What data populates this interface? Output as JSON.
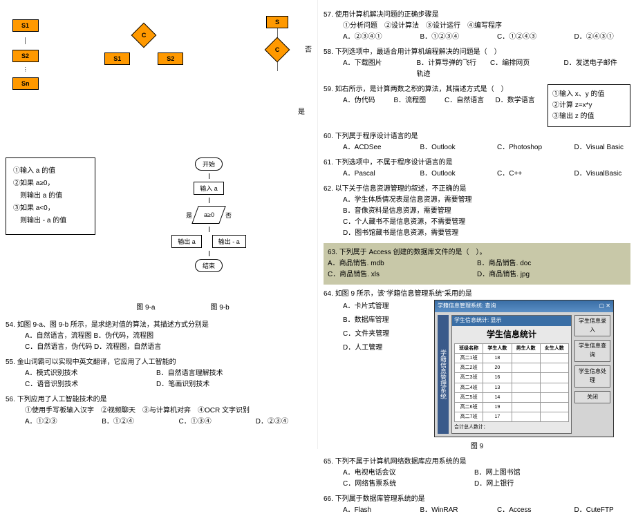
{
  "left": {
    "diag_seq": {
      "s1": "S1",
      "s2": "S2",
      "sn": "Sn"
    },
    "diag_branch": {
      "c": "C",
      "s1": "S1",
      "s2": "S2"
    },
    "diag_loop": {
      "s": "S",
      "c": "C",
      "no": "否",
      "yes": "是"
    },
    "pseudo": {
      "l1": "①输入 a 的值",
      "l2": "②如果 a≥0，",
      "l3": "则输出 a 的值",
      "l4": "③如果 a<0，",
      "l5": "则输出 - a 的值"
    },
    "flowchart": {
      "start": "开始",
      "input": "输入 a",
      "cond": "a≥0",
      "no": "否",
      "yes": "是",
      "out1": "输出 a",
      "out2": "输出 - a",
      "end": "结束"
    },
    "fig_a": "图 9-a",
    "fig_b": "图 9-b",
    "q54": {
      "num": "54.",
      "text": "如图 9-a、图 9-b 所示，是求绝对值的算法，其描述方式分别是",
      "a": "A．自然语言，流程图  B．伪代码，流程图",
      "c": "C．自然语言，伪代码  D．流程图，自然语言"
    },
    "q55": {
      "num": "55.",
      "text": "金山词霸可以实现中英文翻译，它应用了人工智能的",
      "a": "A．模式识别技术",
      "b": "B．自然语言理解技术",
      "c": "C．语音识别技术",
      "d": "D．笔画识别技术"
    },
    "q56": {
      "num": "56.",
      "text": "下列应用了人工智能技术的是",
      "sub": "①使用手写板输入汉字　②视频聊天　③与计算机对弈　④OCR 文字识别",
      "a": "A．①②③",
      "b": "B．①②④",
      "c": "C．①③④",
      "d": "D．②③④"
    }
  },
  "right": {
    "q57": {
      "num": "57.",
      "text": "使用计算机解决问题的正确步骤是",
      "sub": "①分析问题　②设计算法　③设计运行　④编写程序",
      "a": "A．②③④①",
      "b": "B．①②③④",
      "c": "C．①②④③",
      "d": "D．②④③①"
    },
    "q58": {
      "num": "58.",
      "text": "下列选项中，最适合用计算机编程解决的问题是（　）",
      "a": "A．下载图片",
      "b": "B．计算导弹的飞行轨迹",
      "c": "C．编排网页",
      "d": "D．发送电子邮件"
    },
    "q59": {
      "num": "59.",
      "text": "如右所示，是计算两数之积的算法，其描述方式是（　）",
      "a": "A．伪代码",
      "b": "B．流程图",
      "c": "C．自然语言",
      "d": "D．数学语言",
      "box1": "①输入 x、y 的值",
      "box2": "②计算 z=x*y",
      "box3": "③输出 z 的值"
    },
    "q60": {
      "num": "60.",
      "text": "下列属于程序设计语言的是",
      "a": "A．ACDSee",
      "b": "B．Outlook",
      "c": "C．Photoshop",
      "d": "D．Visual Basic"
    },
    "q61": {
      "num": "61.",
      "text": "下列选项中，不属于程序设计语言的是",
      "a": "A．Pascal",
      "b": "B．Outlook",
      "c": "C．C++",
      "d": "D．VisualBasic"
    },
    "q62": {
      "num": "62.",
      "text": "以下关于信息资源管理的叙述，不正确的是",
      "a": "A．学生体质情况表是信息资源，需要管理",
      "b": "B．音像资料是信息资源，需要管理",
      "c": "C．个人藏书不是信息资源，不需要管理",
      "d": "D．图书馆藏书是信息资源，需要管理"
    },
    "q63": {
      "num": "63.",
      "text": "下列属于 Access 创建的数据库文件的是（　）。",
      "a": "A．商品销售. mdb",
      "b": "B．商品销售. doc",
      "c": "C．商品销售. xls",
      "d": "D．商品销售. jpg"
    },
    "q64": {
      "num": "64.",
      "text": "如图 9 所示，该\"学籍信息管理系统\"采用的是",
      "a": "A．卡片式管理",
      "b": "B．数据库管理",
      "c": "C．文件夹管理",
      "d": "D．人工管理"
    },
    "app": {
      "win_title": "学籍信息管理系统: 查询",
      "side": "学籍信息管理系统",
      "sub_title": "学生信息统计: 显示",
      "heading": "学生信息统计",
      "btn1": "学生信息录入",
      "btn2": "学生信息查询",
      "btn3": "学生信息处理",
      "btn_close": "关闭",
      "th1": "班级名称",
      "th2": "学生人数",
      "th3": "男生人数",
      "th4": "女生人数",
      "rows": [
        [
          "高二1班",
          "18",
          "",
          ""
        ],
        [
          "高二2班",
          "20",
          "",
          ""
        ],
        [
          "高二3班",
          "16",
          "",
          ""
        ],
        [
          "高二4班",
          "13",
          "",
          ""
        ],
        [
          "高二5班",
          "14",
          "",
          ""
        ],
        [
          "高二6班",
          "19",
          "",
          ""
        ],
        [
          "高二7班",
          "17",
          "",
          ""
        ]
      ],
      "footer": "合计总人数计："
    },
    "fig9": "图 9",
    "q65": {
      "num": "65.",
      "text": "下列不属于计算机网络数据库应用系统的是",
      "a": "A．电视电话会议",
      "b": "B．网上图书馆",
      "c": "C．网络售票系统",
      "d": "D．网上银行"
    },
    "q66": {
      "num": "66.",
      "text": "下列属于数据库管理系统的是",
      "a": "A．Flash",
      "b": "B．WinRAR",
      "c": "C．Access",
      "d": "D．CuteFTP"
    }
  }
}
